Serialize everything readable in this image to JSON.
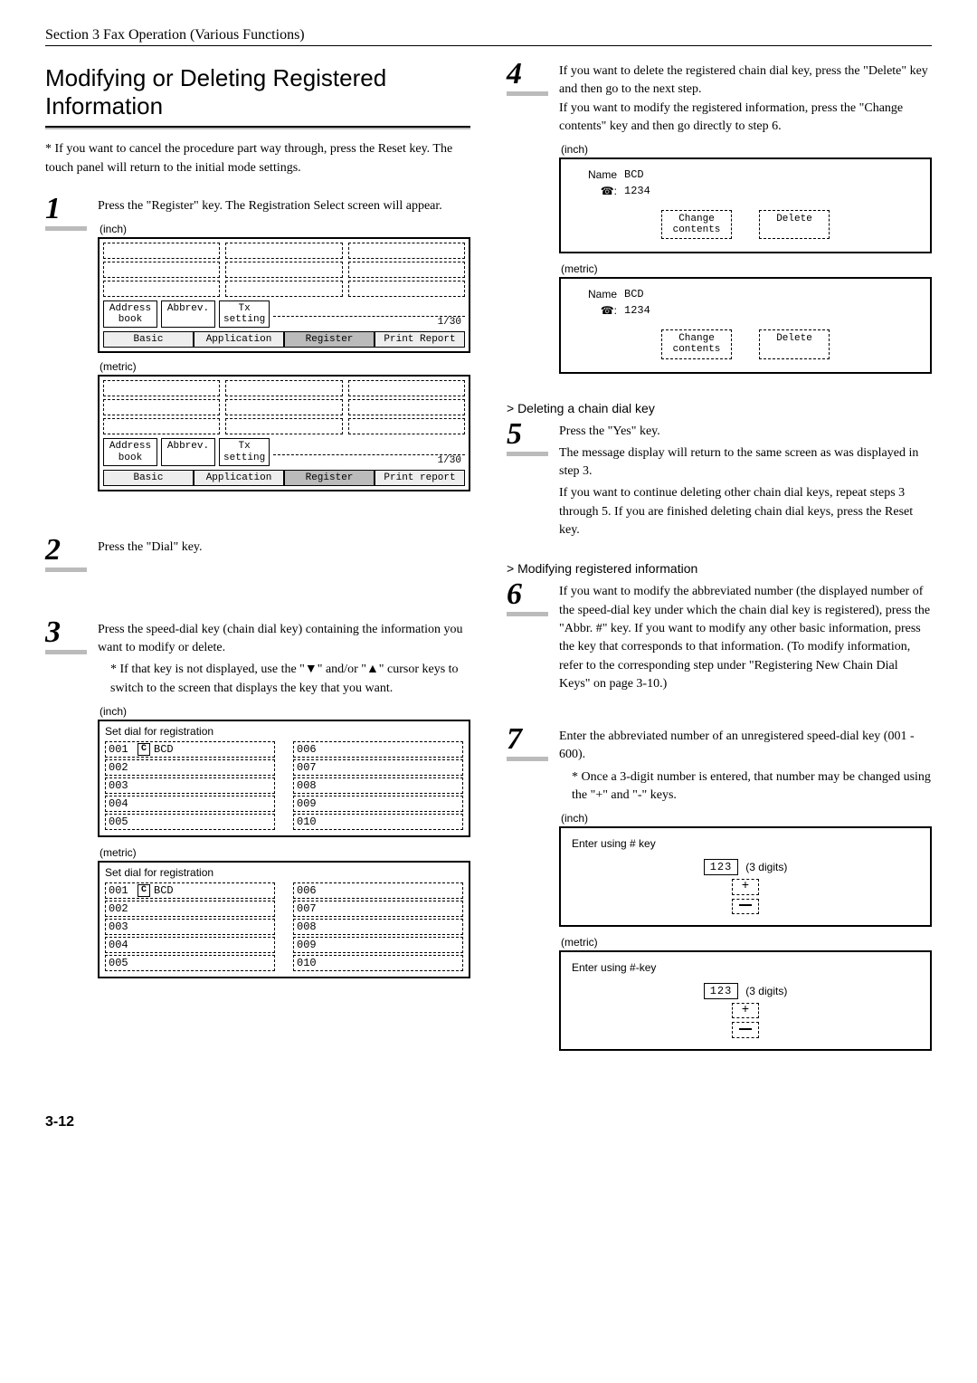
{
  "section_header": "Section 3  Fax Operation (Various Functions)",
  "title": "Modifying or Deleting Registered Information",
  "cancel_note": "* If you want to cancel the procedure part way through, press the Reset key. The touch panel will return to the initial mode settings.",
  "page_number": "3-12",
  "labels": {
    "inch": "(inch)",
    "metric": "(metric)"
  },
  "step1": {
    "text": "Press the \"Register\" key. The Registration Select screen will appear.",
    "tabs": {
      "address_book": "Address\nbook",
      "abbrev": "Abbrev.",
      "tx_setting": "Tx\nsetting",
      "page": "1/30"
    },
    "bottom_tabs": {
      "basic": "Basic",
      "application": "Application",
      "register": "Register",
      "print_report_inch": "Print Report",
      "print_report_metric": "Print report"
    }
  },
  "step2": {
    "text": "Press the \"Dial\" key."
  },
  "step3": {
    "text": "Press the speed-dial key (chain dial key) containing the information you want to modify or delete.",
    "note": "* If that key is not displayed, use the \"▼\" and/or \"▲\" cursor keys to switch to the screen that displays the key that you want.",
    "panel_title": "Set dial for registration",
    "rows_left": [
      {
        "num": "001",
        "chain": "C",
        "name": "BCD"
      },
      {
        "num": "002"
      },
      {
        "num": "003"
      },
      {
        "num": "004"
      },
      {
        "num": "005"
      }
    ],
    "rows_right": [
      {
        "num": "006"
      },
      {
        "num": "007"
      },
      {
        "num": "008"
      },
      {
        "num": "009"
      },
      {
        "num": "010"
      }
    ]
  },
  "step4": {
    "text": "If you want to delete the registered chain dial key, press the \"Delete\" key and then go to the next step.\nIf you want to modify the registered information, press the \"Change contents\" key and then go directly to step 6.",
    "name_label": "Name",
    "name_value": "BCD",
    "phone_label": ":",
    "phone_value": "1234",
    "change_btn": "Change\ncontents",
    "delete_btn": "Delete"
  },
  "subheading_delete": {
    "title": "> Deleting a chain dial key",
    "step5_line1": "Press the \"Yes\" key.",
    "step5_line2": "The message display will return to the same screen as was displayed in step 3.",
    "step5_line3": "If you want to continue deleting other chain dial keys, repeat steps 3 through 5. If you are finished deleting chain dial keys, press the Reset key."
  },
  "subheading_modify": {
    "title": "> Modifying registered information",
    "step6": "If you want to modify the abbreviated number (the displayed number of the speed-dial key under which the chain dial key is registered), press the \"Abbr. #\" key. If you want to modify any other basic information, press the key that corresponds to that information. (To modify information, refer to the corresponding step under \"Registering New Chain Dial Keys\" on page 3-10.)"
  },
  "step7": {
    "text": "Enter the abbreviated number of an unregistered speed-dial key (001 - 600).",
    "note": "* Once a 3-digit number is entered, that number may be changed using the \"+\" and \"-\" keys.",
    "prompt_inch": "Enter using # key",
    "prompt_metric": "Enter using #-key",
    "value": "123",
    "digits_hint": "(3 digits)",
    "plus": "+",
    "minus": "−"
  }
}
